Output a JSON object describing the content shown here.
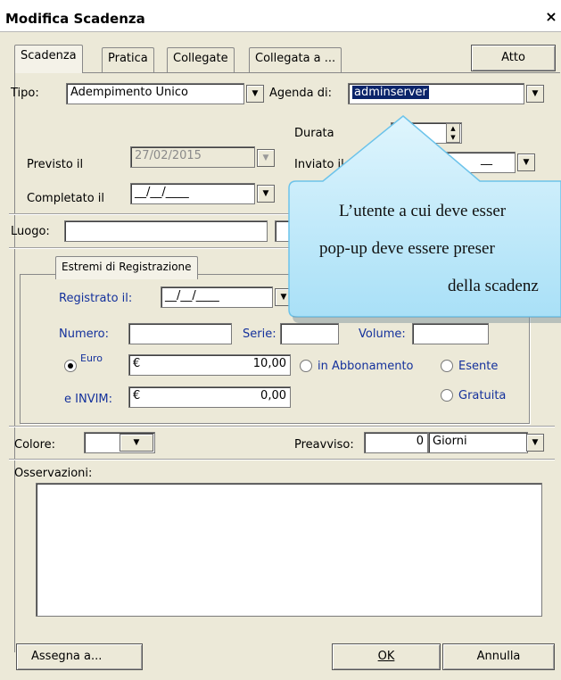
{
  "window": {
    "title": "Modifica Scadenza",
    "close_glyph": "×"
  },
  "tabs": [
    "Scadenza",
    "Pratica",
    "Collegate",
    "Collegata a ..."
  ],
  "atto_button": "Atto",
  "tipo": {
    "label": "Tipo:",
    "value": "Adempimento Unico"
  },
  "agenda": {
    "label": "Agenda di:",
    "value": "adminserver"
  },
  "durata": {
    "label": "Durata"
  },
  "previsto": {
    "label": "Previsto il",
    "value": "27/02/2015"
  },
  "inviato": {
    "label": "Inviato il",
    "value": "__"
  },
  "completato": {
    "label": "Completato il",
    "value": "__/__/____"
  },
  "luogo": {
    "label": "Luogo:"
  },
  "registrazione": {
    "group_title": "Estremi di Registrazione",
    "registrato_label": "Registrato il:",
    "registrato_value": "__/__/____",
    "numero_label": "Numero:",
    "serie_label": "Serie:",
    "volume_label": "Volume:",
    "euro_label": "Euro",
    "euro_value": "10,00",
    "currency": "€",
    "invim_label": "e INVIM:",
    "invim_value": "0,00",
    "opt_abbonamento": "in Abbonamento",
    "opt_esente": "Esente",
    "opt_gratuita": "Gratuita"
  },
  "colore": {
    "label": "Colore:"
  },
  "preavviso": {
    "label": "Preavviso:",
    "value": "0",
    "unit": "Giorni"
  },
  "osservazioni": {
    "label": "Osservazioni:"
  },
  "footer": {
    "assegna": "Assegna a...",
    "ok": "OK",
    "annulla": "Annulla"
  },
  "callout": {
    "line1": "L’utente a cui deve esser",
    "line2": "pop-up deve essere preser",
    "line3": "della scadenz"
  },
  "colors": {
    "accent": "#0a246a",
    "blue_label": "#14319c",
    "callout_fill": "#c9ecfb"
  }
}
